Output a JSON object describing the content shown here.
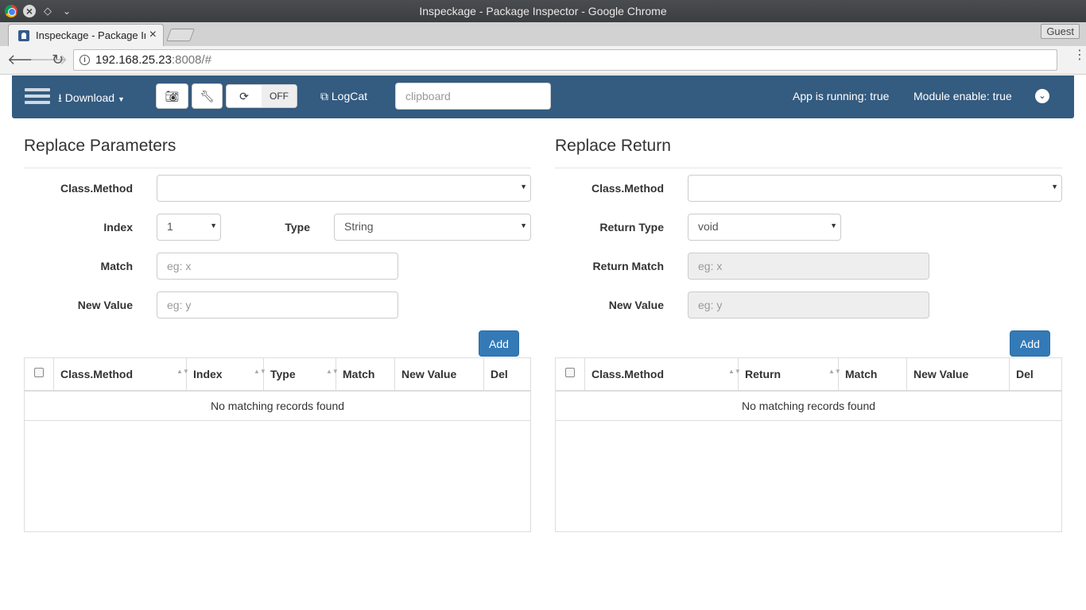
{
  "window": {
    "title": "Inspeckage - Package Inspector - Google Chrome"
  },
  "browser": {
    "tab_title": "Inspeckage - Package Inspector",
    "guest_label": "Guest",
    "url_host": "192.168.25.23",
    "url_rest": ":8008/#"
  },
  "navbar": {
    "download_label": "Download",
    "toggle_state": "OFF",
    "logcat_label": "LogCat",
    "clipboard_placeholder": "clipboard",
    "app_running": "App is running: true",
    "module_enable": "Module enable: true"
  },
  "replace_parameters": {
    "title": "Replace Parameters",
    "class_method_label": "Class.Method",
    "class_method_value": "",
    "index_label": "Index",
    "index_value": "1",
    "type_label": "Type",
    "type_value": "String",
    "match_label": "Match",
    "match_placeholder": "eg: x",
    "new_value_label": "New Value",
    "new_value_placeholder": "eg: y",
    "add_label": "Add",
    "columns": [
      "Class.Method",
      "Index",
      "Type",
      "Match",
      "New Value",
      "Del"
    ],
    "empty_text": "No matching records found"
  },
  "replace_return": {
    "title": "Replace Return",
    "class_method_label": "Class.Method",
    "class_method_value": "",
    "return_type_label": "Return Type",
    "return_type_value": "void",
    "return_match_label": "Return Match",
    "return_match_placeholder": "eg: x",
    "new_value_label": "New Value",
    "new_value_placeholder": "eg: y",
    "add_label": "Add",
    "columns": [
      "Class.Method",
      "Return",
      "Match",
      "New Value",
      "Del"
    ],
    "empty_text": "No matching records found"
  },
  "colors": {
    "navbar": "#345b80",
    "primary_button": "#337ab7"
  }
}
